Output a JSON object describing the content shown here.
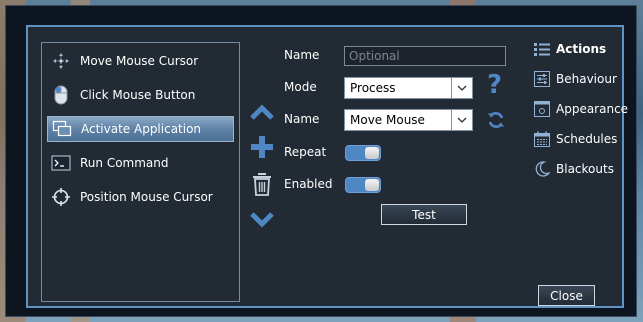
{
  "actions_list": [
    {
      "label": "Move Mouse Cursor",
      "icon": "move-cursor-icon",
      "selected": false
    },
    {
      "label": "Click Mouse Button",
      "icon": "mouse-icon",
      "selected": false
    },
    {
      "label": "Activate Application",
      "icon": "windows-icon",
      "selected": true
    },
    {
      "label": "Run Command",
      "icon": "terminal-icon",
      "selected": false
    },
    {
      "label": "Position Mouse Cursor",
      "icon": "crosshair-icon",
      "selected": false
    }
  ],
  "form": {
    "name_label": "Name",
    "name_placeholder": "Optional",
    "name_value": "",
    "mode_label": "Mode",
    "mode_value": "Process",
    "name2_label": "Name",
    "name2_value": "Move Mouse",
    "repeat_label": "Repeat",
    "repeat_on": true,
    "enabled_label": "Enabled",
    "enabled_on": true,
    "test_label": "Test",
    "help_glyph": "?"
  },
  "nav": {
    "items": [
      {
        "label": "Actions",
        "icon": "list-icon",
        "active": true
      },
      {
        "label": "Behaviour",
        "icon": "sliders-icon",
        "active": false
      },
      {
        "label": "Appearance",
        "icon": "appearance-icon",
        "active": false
      },
      {
        "label": "Schedules",
        "icon": "calendar-icon",
        "active": false
      },
      {
        "label": "Blackouts",
        "icon": "moon-icon",
        "active": false
      }
    ]
  },
  "footer": {
    "close_label": "Close"
  },
  "colors": {
    "accent": "#5e93c4",
    "icon_blue": "#4f86c4",
    "panel": "#222a33",
    "window": "#0c1520"
  }
}
